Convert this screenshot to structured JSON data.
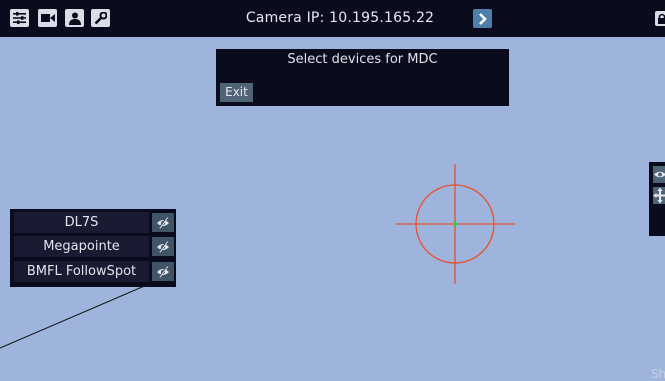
{
  "topbar": {
    "title": "Camera IP: 10.195.165.22",
    "icons": [
      "sliders-icon",
      "video-camera-icon",
      "user-icon",
      "wrench-icon",
      "chevron-right-icon",
      "lock-icon"
    ]
  },
  "mdc_dialog": {
    "title": "Select devices for MDC",
    "exit_label": "Exit"
  },
  "devices": [
    {
      "name": "DL7S",
      "visibility": "hidden"
    },
    {
      "name": "Megapointe",
      "visibility": "hidden"
    },
    {
      "name": "BMFL FollowSpot",
      "visibility": "hidden"
    }
  ],
  "right_panel": {
    "icons": [
      "eye-icon",
      "move-icon"
    ]
  },
  "footer": {
    "show_text": "Show"
  },
  "colors": {
    "background": "#9fb4dd",
    "bar": "#0b0b1e",
    "button": "#4f6577",
    "accent": "#4d7fa8",
    "crosshair": "#e8502a",
    "center_dot": "#2bd14a"
  }
}
